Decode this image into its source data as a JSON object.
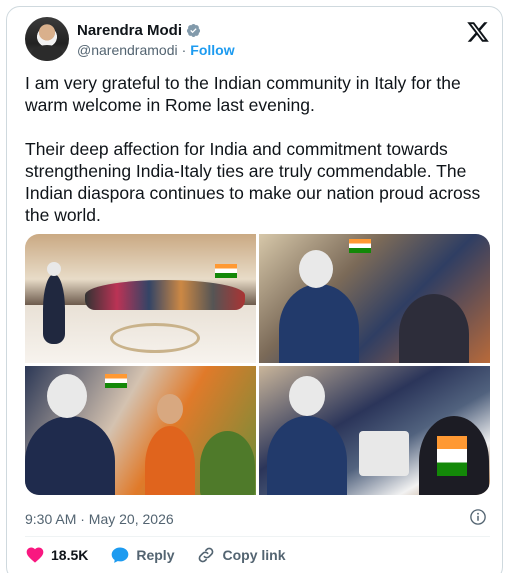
{
  "author": {
    "name": "Narendra Modi",
    "handle": "@narendramodi",
    "separator": "·",
    "follow_label": "Follow"
  },
  "tweet": {
    "text": "I am very grateful to the Indian community in Italy for the warm welcome in Rome last evening.\n\nTheir deep affection for India and commitment towards strengthening India-Italy ties are truly commendable. The Indian diaspora continues to make our nation proud across the world.",
    "timestamp": "9:30 AM · May 20, 2026"
  },
  "actions": {
    "likes": "18.5K",
    "reply_label": "Reply",
    "copy_label": "Copy link"
  },
  "colors": {
    "accent": "#1d9bf0",
    "like": "#f91880",
    "muted": "#536471",
    "text": "#0f1419"
  },
  "icons": [
    "verified-badge-icon",
    "x-logo-icon",
    "info-icon",
    "heart-icon",
    "reply-bubble-icon",
    "link-icon"
  ]
}
